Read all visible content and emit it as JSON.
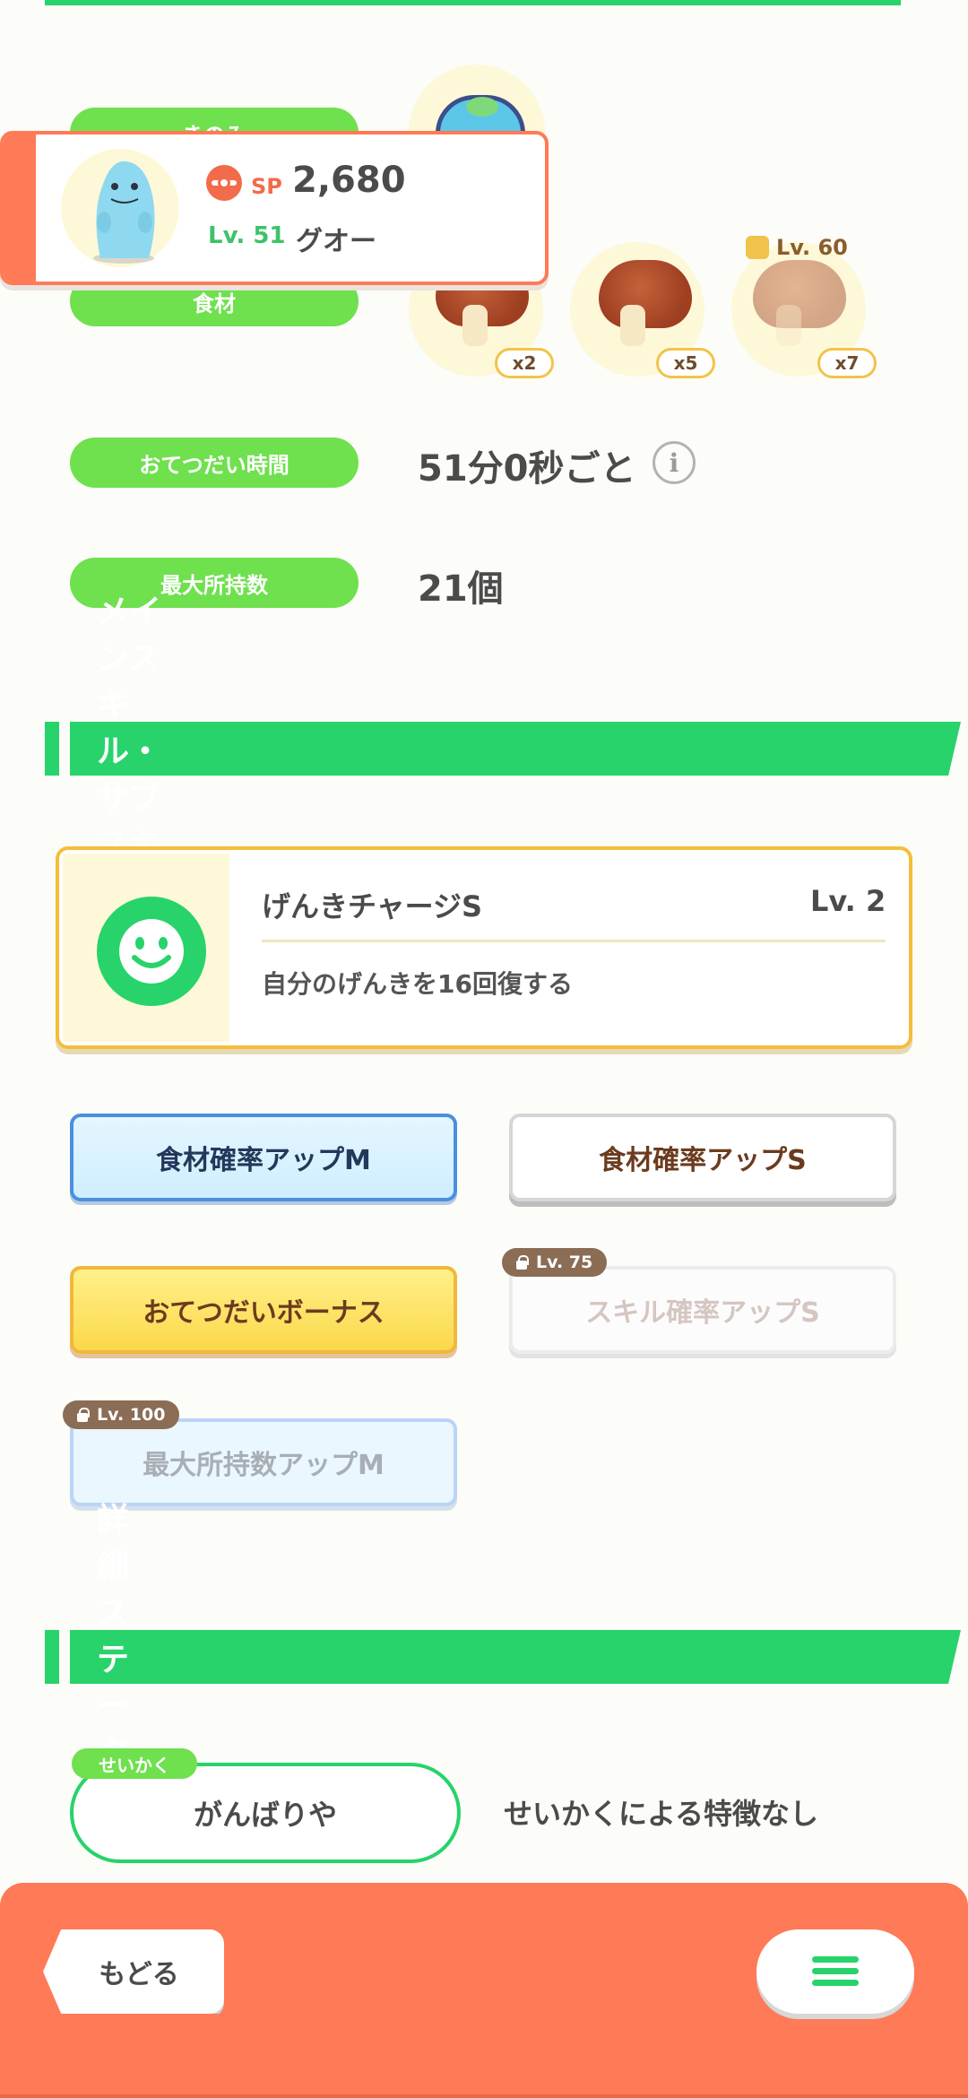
{
  "header_popup": {
    "sp_label": "SP",
    "sp_value": "2,680",
    "level": "Lv. 51",
    "pokemon_name": "グオー"
  },
  "info": {
    "berry_label": "きのみ",
    "ingredient_label": "食材",
    "ingredients": [
      {
        "count": "x2",
        "locked_level": ""
      },
      {
        "count": "x5",
        "locked_level": ""
      },
      {
        "count": "x7",
        "locked_level": "Lv. 60"
      }
    ],
    "help_time_label": "おてつだい時間",
    "help_time_value": "51分0秒ごと",
    "max_carry_label": "最大所持数",
    "max_carry_value": "21個"
  },
  "skills_section": {
    "title": "メインスキル・サブスキル",
    "main_skill": {
      "name": "げんきチャージS",
      "level": "Lv. 2",
      "description": "自分のげんきを16回復する"
    },
    "sub_skills": [
      {
        "label": "食材確率アップM",
        "lock": ""
      },
      {
        "label": "食材確率アップS",
        "lock": ""
      },
      {
        "label": "おてつだいボーナス",
        "lock": ""
      },
      {
        "label": "スキル確率アップS",
        "lock": "Lv. 75"
      },
      {
        "label": "最大所持数アップM",
        "lock": "Lv. 100"
      }
    ]
  },
  "details_section": {
    "title": "詳細ステータス",
    "nature_tag": "せいかく",
    "nature_value": "がんばりや",
    "nature_effect": "せいかくによる特徴なし"
  },
  "bottom_bar": {
    "back_label": "もどる"
  }
}
